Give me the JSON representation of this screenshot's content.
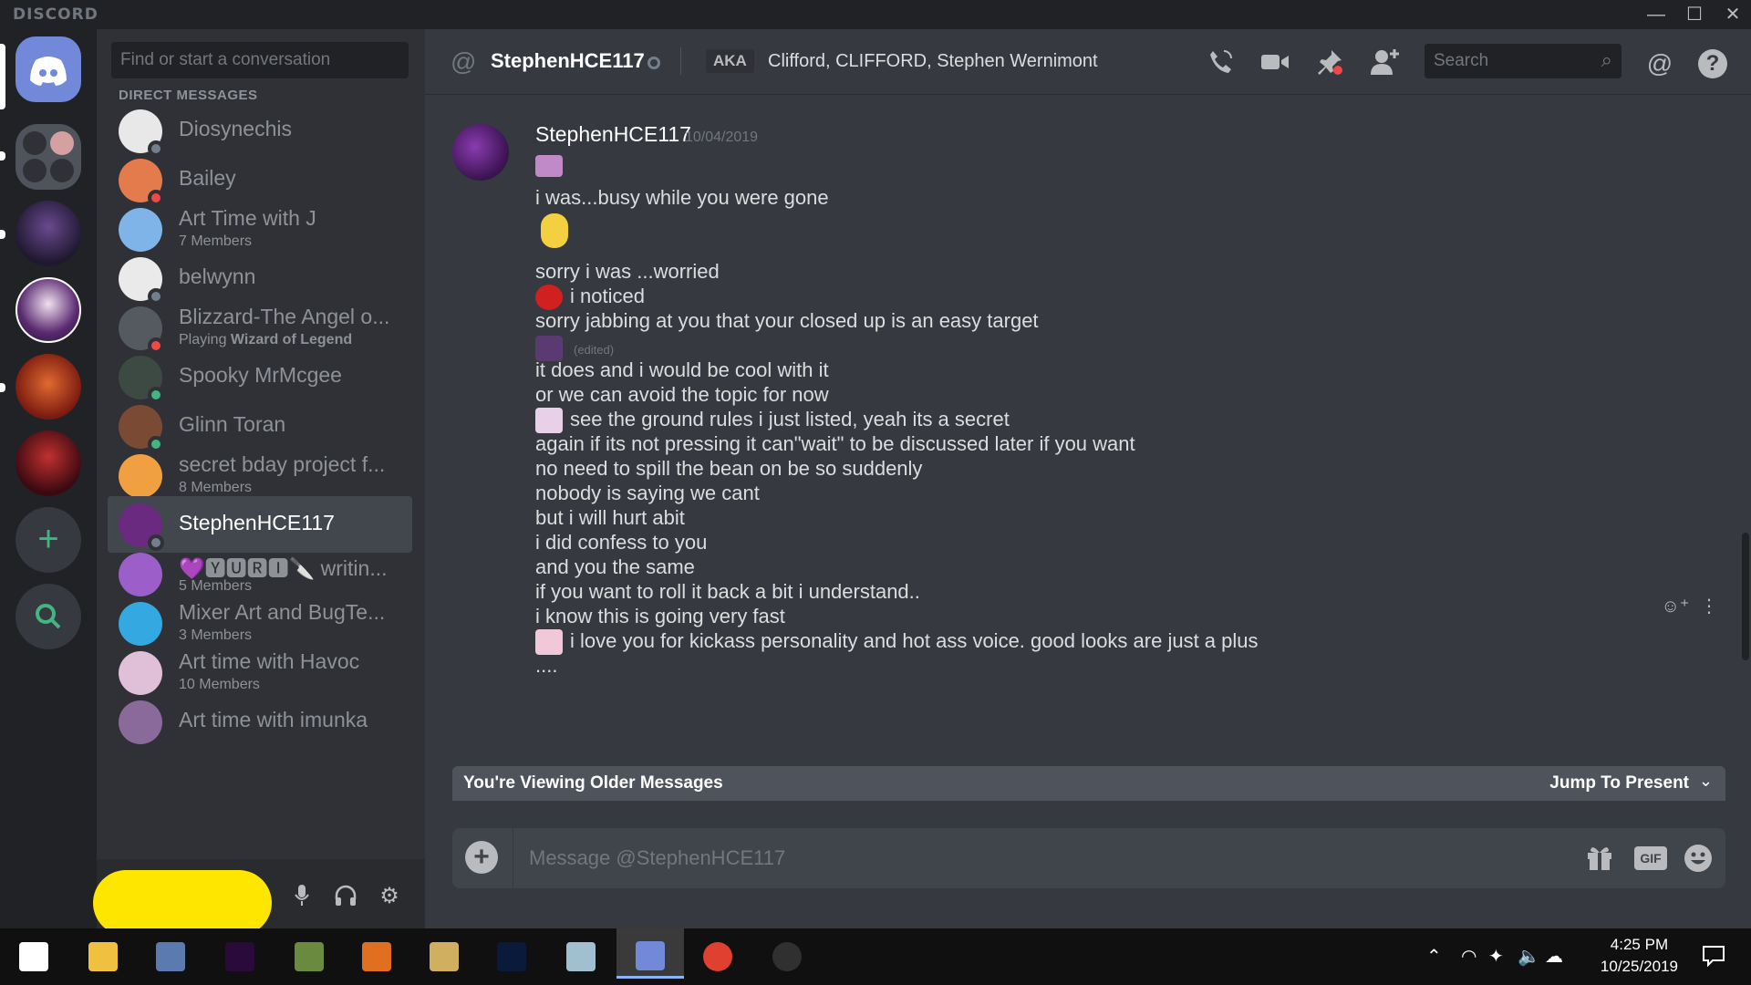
{
  "app": {
    "brand": "DISCORD"
  },
  "window_controls": {
    "minimize": "—",
    "maximize": "☐",
    "close": "✕"
  },
  "dm_sidebar": {
    "search_placeholder": "Find or start a conversation",
    "heading": "DIRECT MESSAGES",
    "items": [
      {
        "name": "Diosynechis",
        "sub": "",
        "status": "offline",
        "avatar_color": "#e8e8e8"
      },
      {
        "name": "Bailey",
        "sub": "",
        "status": "dnd",
        "avatar_color": "#e37b4c"
      },
      {
        "name": "Art Time with J",
        "sub": "7 Members",
        "status": "",
        "avatar_color": "#7fb4e8"
      },
      {
        "name": "belwynn",
        "sub": "",
        "status": "offline",
        "avatar_color": "#eaeaea"
      },
      {
        "name": "Blizzard-The Angel o...",
        "sub_prefix": "Playing ",
        "sub_bold": "Wizard of Legend",
        "status": "dnd",
        "avatar_color": "#555a60"
      },
      {
        "name": "Spooky MrMcgee",
        "sub": "",
        "status": "mobile",
        "avatar_color": "#3d4a44"
      },
      {
        "name": "Glinn Toran",
        "sub": "",
        "status": "online",
        "avatar_color": "#7a4a34"
      },
      {
        "name": "secret bday project f...",
        "sub": "8 Members",
        "status": "",
        "avatar_color": "#f0a040"
      },
      {
        "name": "StephenHCE117",
        "sub": "",
        "status": "offline",
        "avatar_color": "#6a2a80"
      },
      {
        "name": "💜🆈🆄🆁🅸🔪 writin...",
        "sub": "5 Members",
        "status": "",
        "avatar_color": "#9c5ec8"
      },
      {
        "name": "Mixer Art and BugTe...",
        "sub": "3 Members",
        "status": "",
        "avatar_color": "#34a8e0"
      },
      {
        "name": "Art time with Havoc",
        "sub": "10 Members",
        "status": "",
        "avatar_color": "#e0c0d8"
      },
      {
        "name": "Art time with imunka",
        "sub": "",
        "status": "",
        "avatar_color": "#8a6a9a"
      }
    ]
  },
  "user_panel": {
    "mic_icon": "microphone-icon",
    "headset_icon": "headphones-icon",
    "settings_icon": "gear-icon"
  },
  "chat": {
    "header": {
      "title": "StephenHCE117",
      "aka_label": "AKA",
      "aliases": "Clifford, CLIFFORD, Stephen Wernimont",
      "search_placeholder": "Search"
    },
    "author": "StephenHCE117",
    "timestamp": "10/04/2019",
    "edited_label": "(edited)",
    "lines": [
      "i was...busy while you were gone",
      "sorry i was ...worried",
      "i noticed",
      "sorry jabbing at you that your closed up is an easy target",
      "it does and i would be cool with it",
      "or we can avoid the topic for now",
      "see the ground rules i just listed, yeah its a secret",
      "again if its not pressing it can\"wait\" to be discussed later if you want",
      "no need to spill the bean on be so suddenly",
      "nobody is saying we cant",
      "but i will hurt abit",
      "i did confess to you",
      "and you the same",
      "if you want to roll it back a bit i understand..",
      "i know this is going very fast",
      "i love you for kickass personality and hot ass voice. good  looks are just a plus",
      "...."
    ],
    "older_banner": {
      "left": "You're Viewing Older Messages",
      "right": "Jump To Present"
    },
    "composer": {
      "placeholder": "Message @StephenHCE117",
      "gif_label": "GIF"
    }
  },
  "taskbar": {
    "clock_time": "4:25 PM",
    "clock_date": "10/25/2019",
    "apps": [
      {
        "name": "windows-start",
        "color": "#ffffff"
      },
      {
        "name": "file-explorer",
        "color": "#f0c040"
      },
      {
        "name": "app-2",
        "color": "#5a7ab0"
      },
      {
        "name": "premiere-pro",
        "color": "#2a0a3a"
      },
      {
        "name": "app-4",
        "color": "#6a8a40"
      },
      {
        "name": "app-5",
        "color": "#e07020"
      },
      {
        "name": "paint-app",
        "color": "#d0b060"
      },
      {
        "name": "photoshop",
        "color": "#0a1a3a"
      },
      {
        "name": "app-8",
        "color": "#a0c0d0"
      },
      {
        "name": "discord",
        "color": "#7289da"
      },
      {
        "name": "chrome",
        "color": "#e04030"
      },
      {
        "name": "obs",
        "color": "#303030"
      }
    ]
  },
  "colors": {
    "blurple": "#7289da",
    "online": "#43b581",
    "dnd": "#f04747",
    "offline": "#747f8d",
    "highlight": "#ffe600"
  }
}
